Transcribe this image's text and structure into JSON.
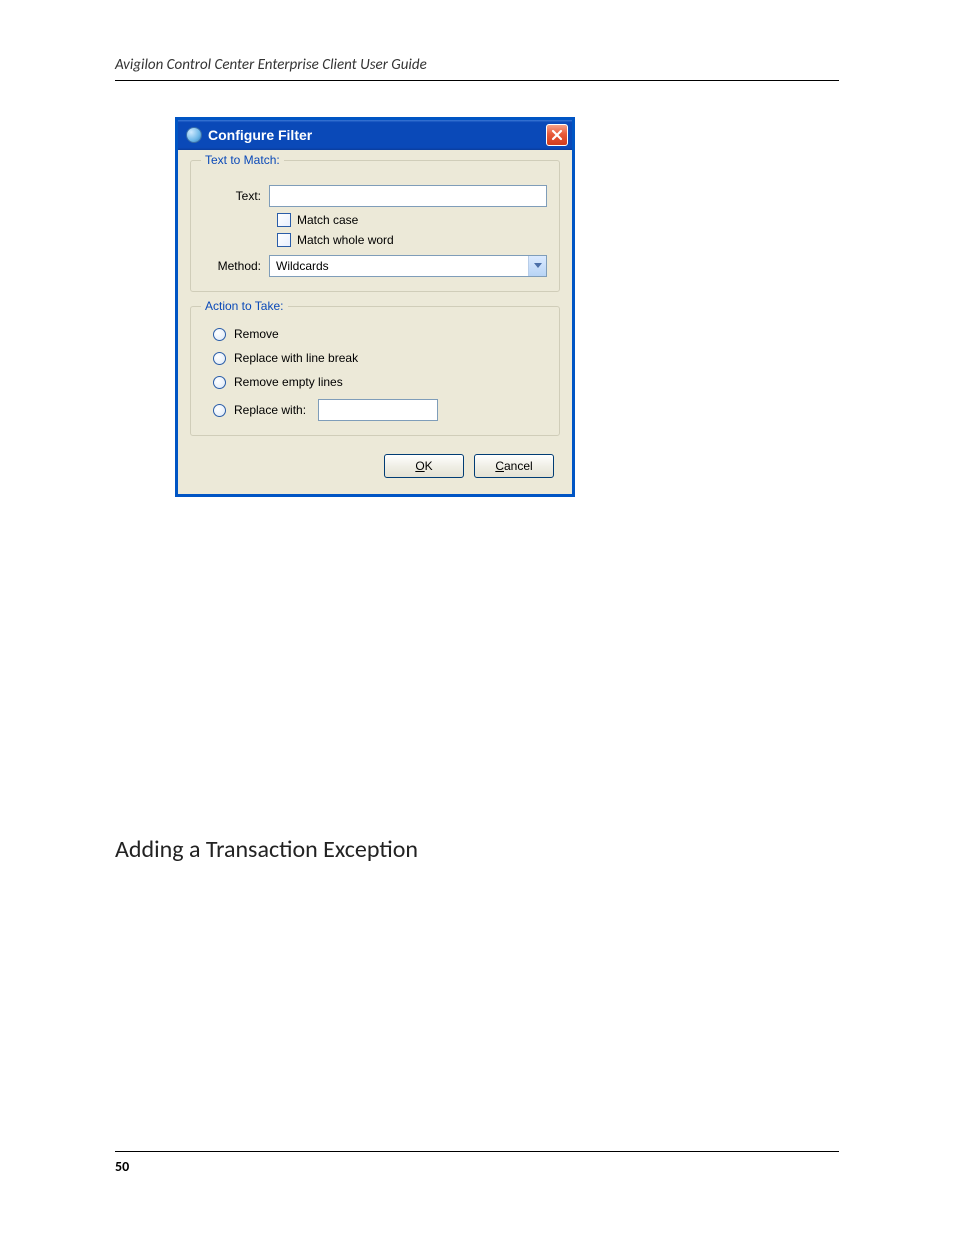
{
  "doc": {
    "header": "Avigilon Control Center Enterprise Client User Guide",
    "page_number": "50"
  },
  "dialog": {
    "title": "Configure Filter",
    "group1": {
      "legend": "Text to Match:",
      "text_label": "Text:",
      "text_value": "",
      "match_case": "Match case",
      "match_whole": "Match whole word",
      "method_label": "Method:",
      "method_value": "Wildcards"
    },
    "group2": {
      "legend": "Action to Take:",
      "opt_remove": "Remove",
      "opt_replace_lb": "Replace with line break",
      "opt_remove_empty": "Remove empty lines",
      "opt_replace_with": "Replace with:",
      "replace_value": ""
    },
    "buttons": {
      "ok_u": "O",
      "ok_rest": "K",
      "cancel_u": "C",
      "cancel_rest": "ancel"
    }
  },
  "section": {
    "heading": "Adding a Transaction Exception"
  }
}
